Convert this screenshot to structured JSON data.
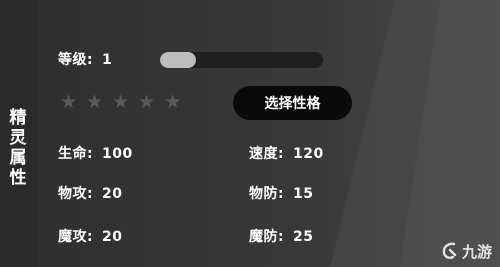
{
  "side_title": [
    "精",
    "灵",
    "属",
    "性"
  ],
  "level": {
    "label": "等级:",
    "value": "1",
    "progress": 0.22
  },
  "stars": {
    "filled": 0,
    "total": 5
  },
  "select_button": {
    "label": "选择性格"
  },
  "stats": {
    "hp": {
      "label": "生命:",
      "value": "100"
    },
    "speed": {
      "label": "速度:",
      "value": "120"
    },
    "atk": {
      "label": "物攻:",
      "value": "20"
    },
    "def": {
      "label": "物防:",
      "value": "15"
    },
    "matk": {
      "label": "魔攻:",
      "value": "20"
    },
    "mdef": {
      "label": "魔防:",
      "value": "25"
    }
  },
  "watermark": {
    "text": "九游"
  },
  "colors": {
    "star_empty": "#5a5a5a",
    "bar_fill": "#bdbdbd",
    "button_bg": "#0a0a0a"
  }
}
